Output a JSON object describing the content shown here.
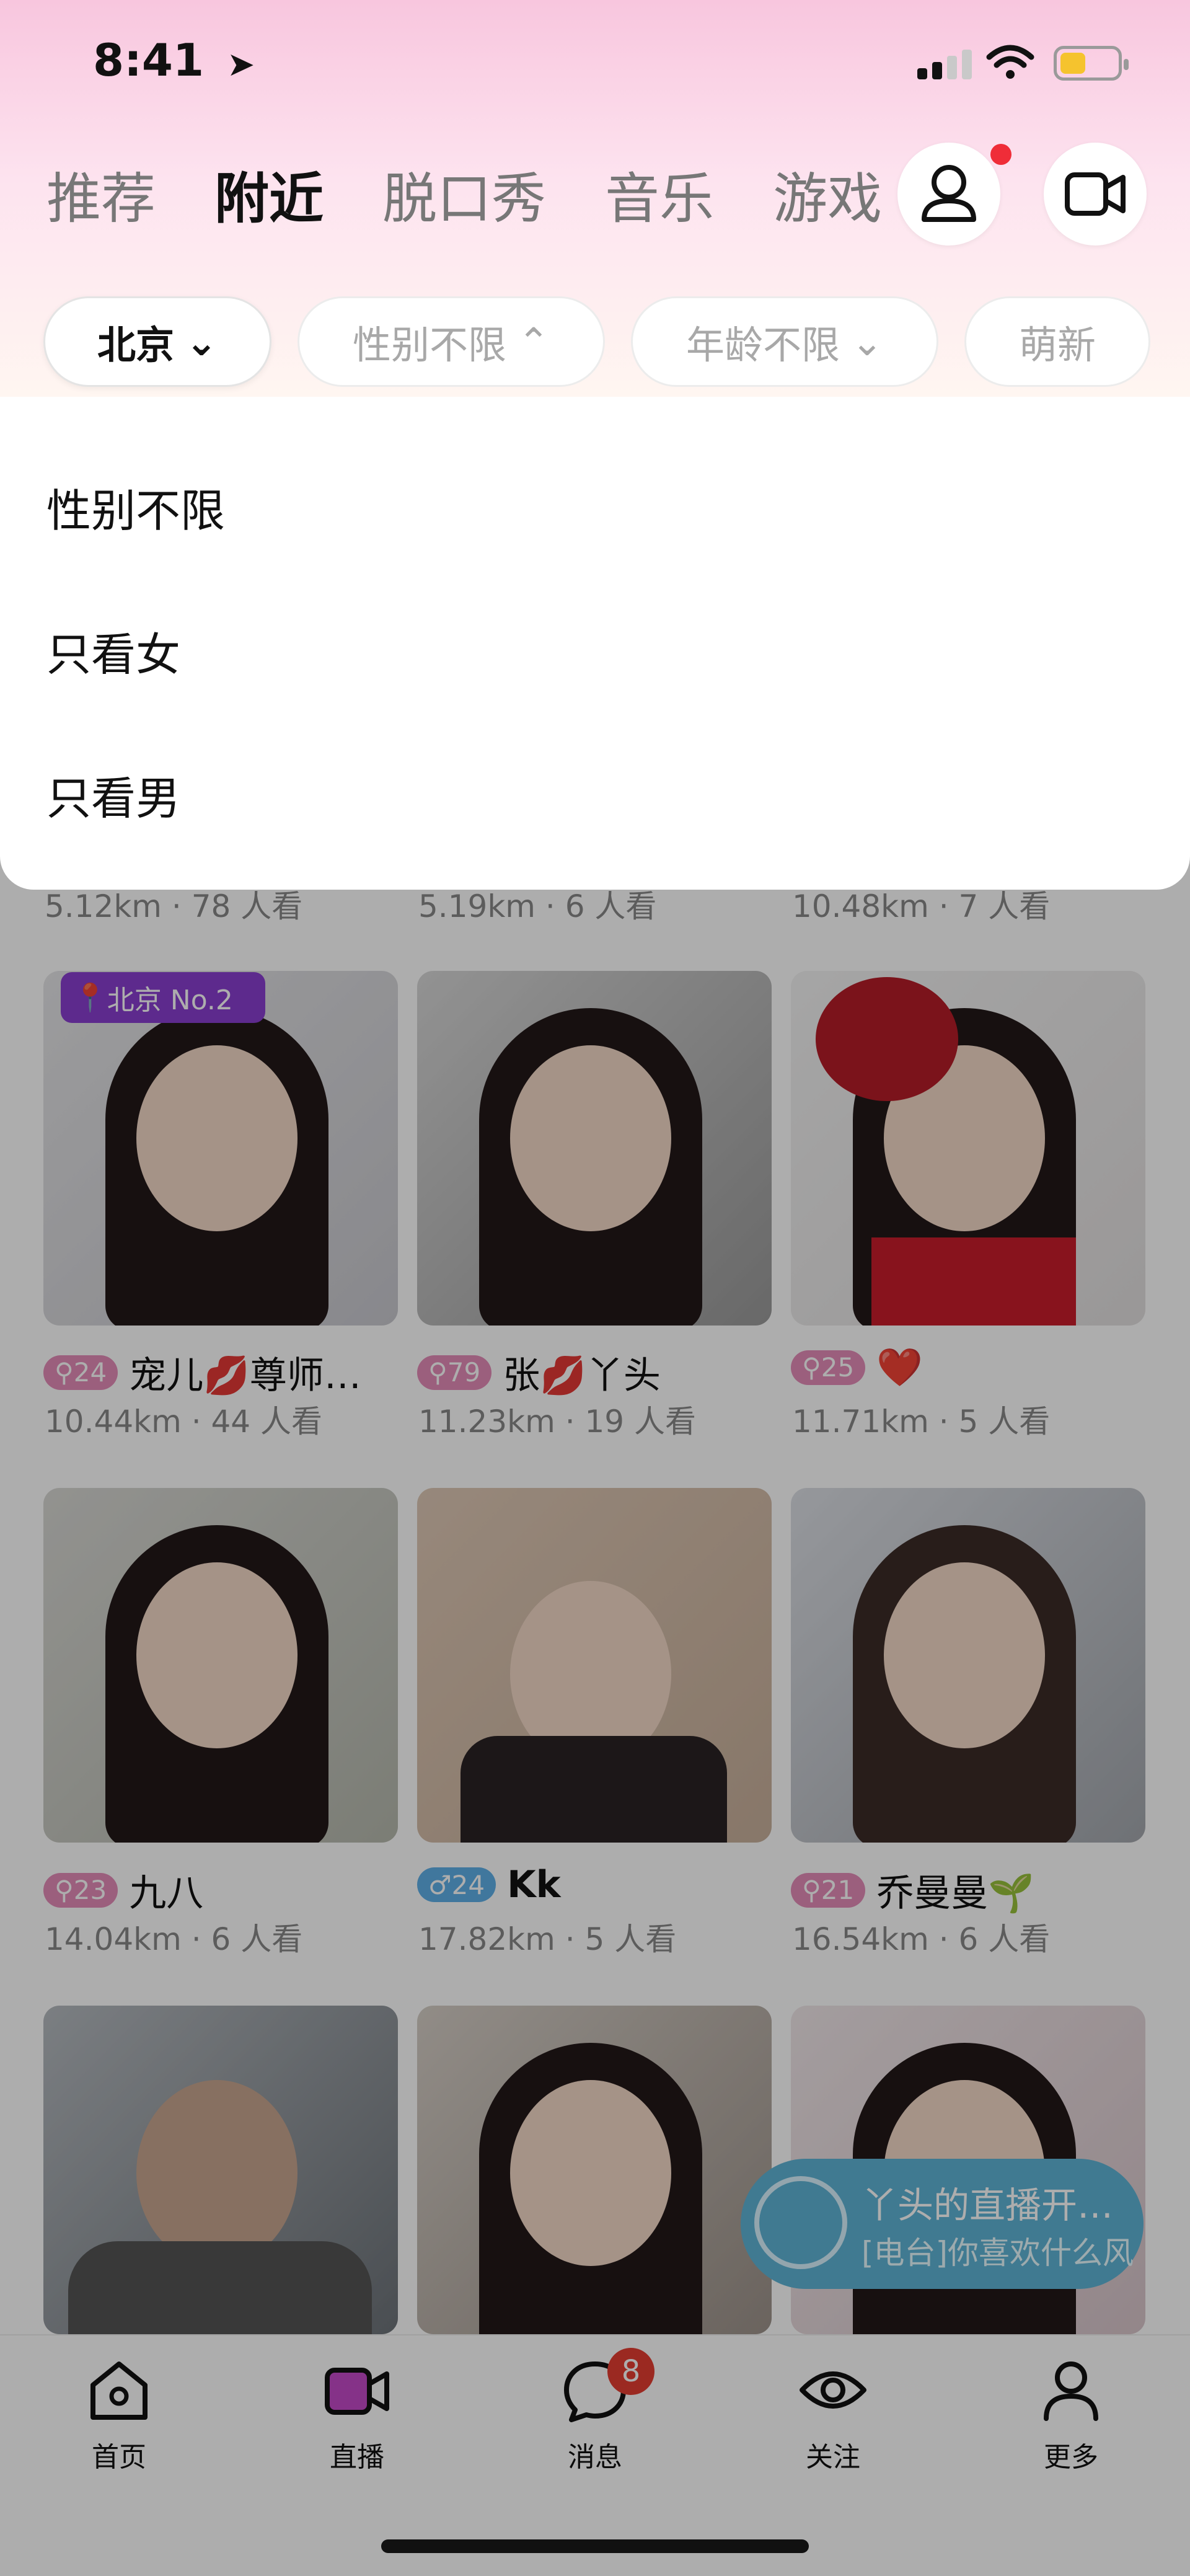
{
  "status_bar": {
    "time": "8:41",
    "location_arrow": "location-arrow-icon",
    "battery_level": 0.4
  },
  "top_tabs": [
    {
      "label": "推荐"
    },
    {
      "label": "附近"
    },
    {
      "label": "脱口秀"
    },
    {
      "label": "音乐"
    },
    {
      "label": "游戏"
    }
  ],
  "header_icons": [
    "user-icon",
    "video-icon"
  ],
  "filters": [
    {
      "label": "北京"
    },
    {
      "label": "性别不限"
    },
    {
      "label": "年龄不限"
    },
    {
      "label": "萌新"
    }
  ],
  "gender_dropdown": {
    "options": [
      "性别不限",
      "只看女",
      "只看男"
    ]
  },
  "first_row_meta": [
    {
      "dist": "5.12km",
      "viewers": "78 人看"
    },
    {
      "dist": "5.19km",
      "viewers": "6 人看"
    },
    {
      "dist": "10.48km",
      "viewers": "7 人看"
    }
  ],
  "badges": {
    "location": "北京 No.2"
  },
  "streamers": [
    {
      "age": "24",
      "gender": "f",
      "name": "宠儿💋尊师…",
      "dist": "10.44km",
      "viewers": "44 人看"
    },
    {
      "age": "79",
      "gender": "f",
      "name": "张💋丫头",
      "dist": "11.23km",
      "viewers": "19 人看"
    },
    {
      "age": "25",
      "gender": "f",
      "name": "❤️",
      "dist": "11.71km",
      "viewers": "5 人看"
    },
    {
      "age": "23",
      "gender": "f",
      "name": "九八",
      "dist": "14.04km",
      "viewers": "6 人看"
    },
    {
      "age": "24",
      "gender": "m",
      "name": "Kk",
      "dist": "17.82km",
      "viewers": "5 人看"
    },
    {
      "age": "21",
      "gender": "f",
      "name": "乔曼曼🌱",
      "dist": "16.54km",
      "viewers": "6 人看"
    }
  ],
  "live_popup": {
    "title": "丫头的直播开…",
    "subtitle": "[电台]你喜欢什么风"
  },
  "bottom_nav": [
    {
      "label": "首页"
    },
    {
      "label": "直播"
    },
    {
      "label": "消息"
    },
    {
      "label": "关注"
    },
    {
      "label": "更多"
    }
  ],
  "messages_badge": "8",
  "colors": {
    "accent_pink": "#e58cb8",
    "male_blue": "#5fb0e7",
    "badge_red": "#e53d32",
    "live_purple": "#c54ac9"
  }
}
